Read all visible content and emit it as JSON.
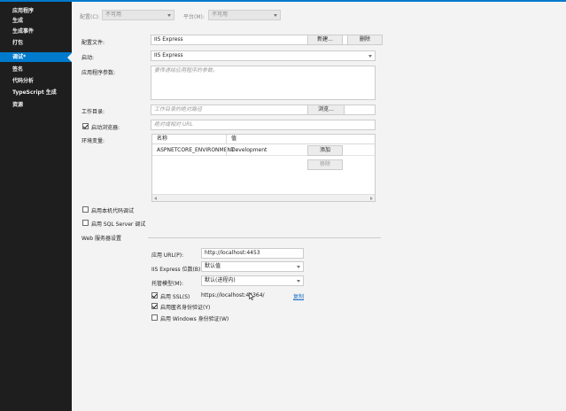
{
  "sidebar": {
    "items": [
      {
        "label": "应用程序"
      },
      {
        "label": "生成"
      },
      {
        "label": "生成事件"
      },
      {
        "label": "打包"
      },
      {
        "label": "调试*"
      },
      {
        "label": "签名"
      },
      {
        "label": "代码分析"
      },
      {
        "label": "TypeScript 生成"
      },
      {
        "label": "资源"
      }
    ],
    "active": "调试*"
  },
  "top": {
    "config_label": "配置(C):",
    "config_value": "不可用",
    "platform_label": "平台(M):",
    "platform_value": "不可用"
  },
  "profile": {
    "label": "配置文件:",
    "value": "IIS Express",
    "new_button": "新建...",
    "delete_button": "删除"
  },
  "launch": {
    "label": "启动:",
    "value": "IIS Express"
  },
  "app_args": {
    "label": "应用程序参数:",
    "placeholder": "要传递给应用程序的参数。"
  },
  "working_dir": {
    "label": "工作目录:",
    "placeholder": "工作目录的绝对路径",
    "browse_button": "浏览..."
  },
  "launch_browser": {
    "label": "启动浏览器:",
    "checked": true,
    "placeholder": "绝对或相对 URL"
  },
  "env": {
    "label": "环境变量:",
    "columns": [
      "名称",
      "值"
    ],
    "rows": [
      {
        "name": "ASPNETCORE_ENVIRONMENT",
        "value": "Development"
      }
    ],
    "add_button": "添加",
    "remove_button": "移除"
  },
  "native_debug": {
    "label": "启用本机代码调试",
    "checked": false
  },
  "sql_debug": {
    "label": "启用 SQL Server 调试",
    "checked": false
  },
  "web_server": {
    "section_title": "Web 服务器设置",
    "app_url_label": "应用 URL(P):",
    "app_url_value": "http://localhost:4453",
    "bitness_label": "IIS Express 位数(B):",
    "bitness_value": "默认值",
    "hosting_label": "托管模型(M):",
    "hosting_value": "默认(进程内)",
    "ssl_label": "启用 SSL(S)",
    "ssl_checked": true,
    "ssl_url": "https://localhost:44364/",
    "copy_link": "复制",
    "anon_label": "启用匿名身份验证(Y)",
    "anon_checked": true,
    "windows_label": "启用 Windows 身份验证(W)",
    "windows_checked": false
  },
  "colors": {
    "accent": "#007acc",
    "sidebar_bg": "#1e1e1e",
    "content_bg": "#f3f3f3",
    "link": "#1a6fc4"
  }
}
